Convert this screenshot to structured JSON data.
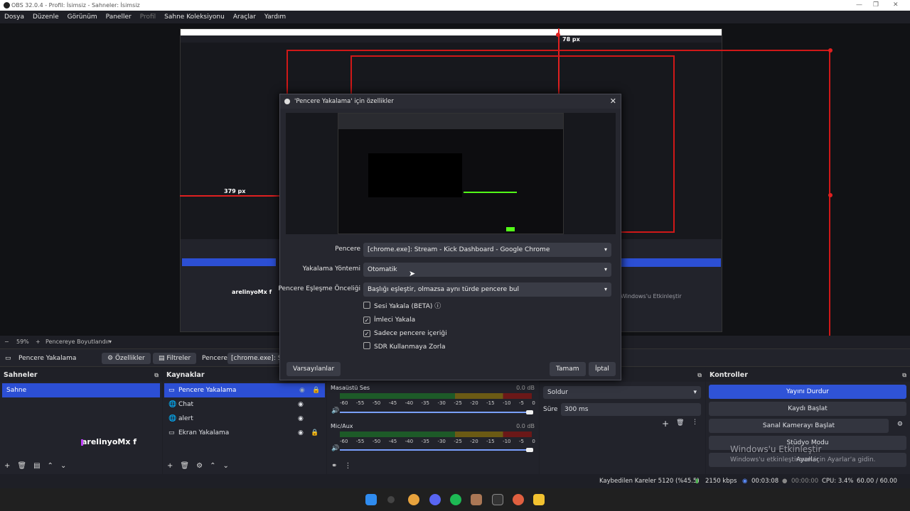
{
  "window": {
    "title": "OBS 32.0.4 - Profil: İsimsiz - Sahneler: İsimsiz",
    "controls": [
      "—",
      "❐",
      "✕"
    ]
  },
  "menu": [
    "Dosya",
    "Düzenle",
    "Görünüm",
    "Paneller",
    "Profil",
    "Sahne Koleksiyonu",
    "Araçlar",
    "Yardım"
  ],
  "preview": {
    "label_top": "78 px",
    "label_left": "379 px",
    "inner_scene_text": "arelinyoMx f"
  },
  "preview_status": {
    "zoom": "59%",
    "fit": "Pencereye Boyutlandır"
  },
  "source_toolbar": {
    "selected_source": "Pencere Yakalama",
    "properties": "Özellikler",
    "filters": "Filtreler",
    "window_label": "Pencere",
    "window_value": "[chrome.exe]: Str"
  },
  "scenes": {
    "title": "Sahneler",
    "items": [
      "Sahne"
    ],
    "overlay_text": "arelinyoMx f"
  },
  "sources": {
    "title": "Kaynaklar",
    "items": [
      "Pencere Yakalama",
      "Chat",
      "alert",
      "Ekran Yakalama"
    ]
  },
  "mixer": {
    "channels": [
      {
        "name": "Masaüstü Ses",
        "db": "0.0 dB"
      },
      {
        "name": "Mic/Aux",
        "db": "0.0 dB"
      }
    ],
    "ticks": [
      "-60",
      "-55",
      "-50",
      "-45",
      "-40",
      "-35",
      "-30",
      "-25",
      "-20",
      "-15",
      "-10",
      "-5",
      "0"
    ]
  },
  "transitions": {
    "type": "Soldur",
    "duration_label": "Süre",
    "duration": "300 ms"
  },
  "controls": {
    "title": "Kontroller",
    "buttons": [
      "Yayını Durdur",
      "Kaydı Başlat",
      "Sanal Kamerayı Başlat",
      "Stüdyo Modu",
      "Ayarlar"
    ]
  },
  "watermark": {
    "line1": "Windows'u Etkinleştir",
    "line2": "Windows'u etkinleştirmek için Ayarlar'a gidin."
  },
  "statusbar": {
    "dropped": "Kaybedilen Kareler 5120 (%45.5)",
    "bitrate": "2150 kbps",
    "stream_time": "00:03:08",
    "rec_time": "00:00:00",
    "cpu": "CPU: 3.4%",
    "fps": "60.00 / 60.00 FPS"
  },
  "dialog": {
    "title": "'Pencere Yakalama' için özellikler",
    "fields": [
      {
        "label": "Pencere",
        "value": "[chrome.exe]: Stream - Kick Dashboard - Google Chrome"
      },
      {
        "label": "Yakalama Yöntemi",
        "value": "Otomatik"
      },
      {
        "label": "Pencere Eşleşme Önceliği",
        "value": "Başlığı eşleştir, olmazsa aynı türde pencere bul"
      }
    ],
    "checkboxes": [
      {
        "label": "Sesi Yakala (BETA)",
        "checked": false
      },
      {
        "label": "İmleci Yakala",
        "checked": true
      },
      {
        "label": "Sadece pencere içeriği",
        "checked": true
      },
      {
        "label": "SDR Kullanmaya Zorla",
        "checked": false
      }
    ],
    "defaults": "Varsayılanlar",
    "ok": "Tamam",
    "cancel": "İptal"
  }
}
